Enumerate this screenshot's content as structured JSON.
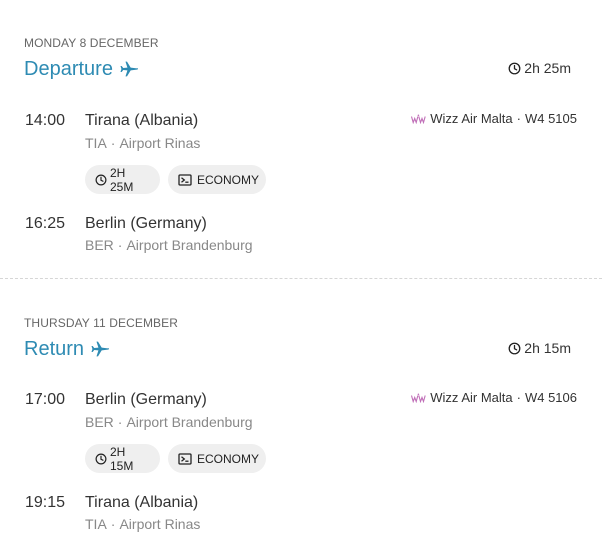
{
  "legs": [
    {
      "id": "departure",
      "date": "MONDAY 8 DECEMBER",
      "title": "Departure",
      "total_duration": "2h 25m",
      "origin": {
        "time": "14:00",
        "city": "Tirana (Albania)",
        "code": "TIA",
        "airport": "Airport Rinas"
      },
      "airline": {
        "name": "Wizz Air Malta",
        "flight": "W4 5105"
      },
      "chips": {
        "duration": "2H 25M",
        "cabin": "ECONOMY"
      },
      "destination": {
        "time": "16:25",
        "city": "Berlin (Germany)",
        "code": "BER",
        "airport": "Airport Brandenburg"
      }
    },
    {
      "id": "return",
      "date": "THURSDAY 11 DECEMBER",
      "title": "Return",
      "total_duration": "2h 15m",
      "origin": {
        "time": "17:00",
        "city": "Berlin (Germany)",
        "code": "BER",
        "airport": "Airport Brandenburg"
      },
      "airline": {
        "name": "Wizz Air Malta",
        "flight": "W4 5106"
      },
      "chips": {
        "duration": "2H 15M",
        "cabin": "ECONOMY"
      },
      "destination": {
        "time": "19:15",
        "city": "Tirana (Albania)",
        "code": "TIA",
        "airport": "Airport Rinas"
      }
    }
  ],
  "colors": {
    "accent": "#2e8bb3",
    "muted_text": "#888888",
    "chip_bg": "#efefef",
    "airline_logo": "#c06fb8"
  },
  "separator": "·",
  "icons": {
    "plane": "airplane-icon",
    "clock": "clock-icon",
    "seat": "seat-icon",
    "airline_logo": "wizz-air-logo"
  }
}
